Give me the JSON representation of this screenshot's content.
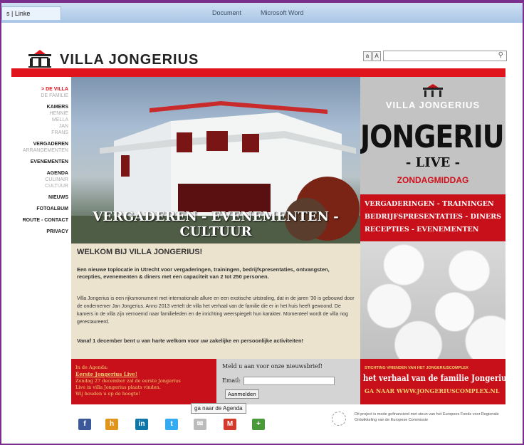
{
  "browser": {
    "tab_title": "s | Linke",
    "other_tabs": [
      "Document",
      "Microsoft Word"
    ]
  },
  "site": {
    "logo_text": "VILLA JONGERIUS",
    "font_small": "a",
    "font_large": "A",
    "search_placeholder": ""
  },
  "sidebar": {
    "groups": [
      {
        "main": "> DE VILLA",
        "active": true,
        "subs": [
          "DE FAMILIE"
        ]
      },
      {
        "main": "KAMERS",
        "subs": [
          "HENNIE",
          "MELLA",
          "JAN",
          "FRANS"
        ]
      },
      {
        "main": "VERGADEREN",
        "subs": [
          "ARRANGEMENTEN"
        ]
      },
      {
        "main": "EVENEMENTEN",
        "subs": []
      },
      {
        "main": "AGENDA",
        "subs": [
          "CULINAIR",
          "CULTUUR"
        ]
      },
      {
        "main": "NIEUWS",
        "subs": []
      },
      {
        "main": "FOTOALBUM",
        "subs": []
      },
      {
        "main": "ROUTE - CONTACT",
        "subs": []
      },
      {
        "main": "PRIVACY",
        "subs": []
      }
    ]
  },
  "hero": {
    "caption": "VERGADEREN - EVENEMENTEN - CULTUUR"
  },
  "welcome": {
    "title": "WELKOM BIJ VILLA JONGERIUS!",
    "intro": "Een nieuwe toplocatie in Utrecht voor vergaderingen, trainingen, bedrijfspresentaties, ontvangsten, recepties, evenementen & diners met een capaciteit van 2 tot 250 personen.",
    "body": "Villa Jongerius is een rijksmonument met internationale allure en een exotische uitstraling, dat in de jaren '30 is gebouwd door de ondernemer Jan Jongerius. Anno 2013 vertelt de villa het verhaal van de familie die er in het huis heeft gewoond. De kamers in de villa zijn vernoemd naar familieleden en de inrichting weerspiegelt hun karakter. Momenteel wordt de villa nog gerestaureerd.",
    "closing": "Vanaf 1 december bent u van harte welkom voor uw zakelijke en persoonlijke activiteiten!"
  },
  "promo": {
    "logo": "VILLA JONGERIUS",
    "big": "JONGERIUS",
    "live": "- LIVE -",
    "day": "ZONDAGMIDDAG",
    "line1": "VERGADERINGEN - TRAININGEN",
    "line2": "BEDRIJFSPRESENTATIES - DINERS",
    "line3": "RECEPTIES - EVENEMENTEN"
  },
  "agenda": {
    "label": "In de Agenda:",
    "title": "Eerste Jongerius Live!",
    "line1": "Zondag 27 december zal de eerste Jongerius",
    "line2": "Live in villa Jongerius plaats vinden.",
    "line3": "Wij houden u op de hoogte!"
  },
  "newsletter": {
    "title": "Meld u aan voor onze nieuwsbrief!",
    "email_label": "Email:",
    "email_value": "",
    "button": "Aanmelden"
  },
  "stichting": {
    "small": "STICHTING VRIENDEN VAN HET JONGERIUSCOMPLEX",
    "title": "het verhaal van de familie Jongerius",
    "link": "GA NAAR WWW.JONGERIUSCOMPLEX.NL"
  },
  "tooltip": "ga naar de Agenda",
  "social": [
    {
      "icon": "facebook-icon",
      "glyph": "f",
      "color": "#3b5998"
    },
    {
      "icon": "hyves-icon",
      "glyph": "h",
      "color": "#e0961c"
    },
    {
      "icon": "linkedin-icon",
      "glyph": "in",
      "color": "#0e76a8"
    },
    {
      "icon": "twitter-icon",
      "glyph": "t",
      "color": "#33aaf1"
    },
    {
      "icon": "email-icon",
      "glyph": "✉",
      "color": "#bbbbbb"
    },
    {
      "icon": "gmail-icon",
      "glyph": "M",
      "color": "#d33a2c"
    },
    {
      "icon": "share-icon",
      "glyph": "+",
      "color": "#4a9a3a"
    }
  ],
  "eu": {
    "text": "Dit project is mede gefinancierd met steun van het Europees Fonds voor Regionale Ontwikkeling van de Europese Commissie"
  }
}
